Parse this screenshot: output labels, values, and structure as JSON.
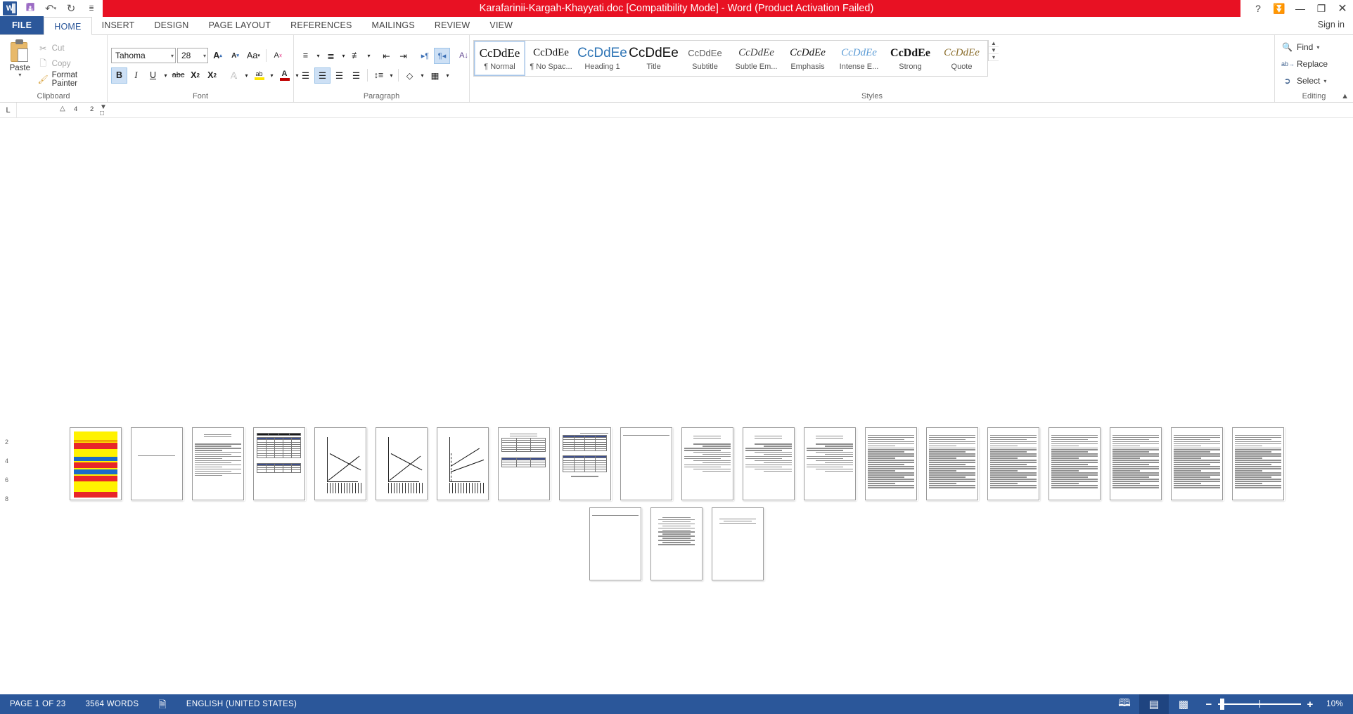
{
  "window": {
    "title": "Karafarinii-Kargah-Khayyati.doc [Compatibility Mode]  -  Word (Product Activation Failed)",
    "quick_access": [
      {
        "name": "word-logo",
        "glyph": "W"
      },
      {
        "name": "save-icon",
        "glyph": "💾"
      },
      {
        "name": "undo-icon",
        "glyph": "↶"
      },
      {
        "name": "redo-icon",
        "glyph": "↻"
      },
      {
        "name": "customize-qat-icon",
        "glyph": "≡"
      }
    ],
    "controls": [
      {
        "name": "help-button",
        "glyph": "?"
      },
      {
        "name": "ribbon-display-options-button",
        "glyph": "⤒"
      },
      {
        "name": "minimize-button",
        "glyph": "—"
      },
      {
        "name": "restore-button",
        "glyph": "❐"
      },
      {
        "name": "close-button",
        "glyph": "✕"
      }
    ],
    "sign_in": "Sign in"
  },
  "tabs": {
    "file": "FILE",
    "items": [
      "HOME",
      "INSERT",
      "DESIGN",
      "PAGE LAYOUT",
      "REFERENCES",
      "MAILINGS",
      "REVIEW",
      "VIEW"
    ],
    "active": "HOME"
  },
  "ribbon": {
    "clipboard": {
      "label": "Clipboard",
      "paste": "Paste",
      "cut": "Cut",
      "copy": "Copy",
      "format_painter": "Format Painter"
    },
    "font": {
      "label": "Font",
      "font_name": "Tahoma",
      "font_size": "28",
      "buttons": [
        {
          "name": "grow-font-button",
          "glyph": "A"
        },
        {
          "name": "shrink-font-button",
          "glyph": "A"
        },
        {
          "name": "change-case-button",
          "glyph": "Aa"
        },
        {
          "name": "clear-formatting-button",
          "glyph": "A"
        },
        {
          "name": "bold-button",
          "glyph": "B"
        },
        {
          "name": "italic-button",
          "glyph": "I"
        },
        {
          "name": "underline-button",
          "glyph": "U"
        },
        {
          "name": "strikethrough-button",
          "glyph": "abc"
        },
        {
          "name": "subscript-button",
          "glyph": "X"
        },
        {
          "name": "superscript-button",
          "glyph": "X"
        },
        {
          "name": "text-effects-button",
          "glyph": "A"
        },
        {
          "name": "text-highlight-color-button",
          "glyph": "ab"
        },
        {
          "name": "font-color-button",
          "glyph": "A"
        }
      ]
    },
    "paragraph": {
      "label": "Paragraph"
    },
    "styles": {
      "label": "Styles",
      "items": [
        {
          "preview": "CcDdEe",
          "name": "¶ Normal",
          "selected": true
        },
        {
          "preview": "CcDdEe",
          "name": "¶ No Spac...",
          "selected": false
        },
        {
          "preview": "CcDdEe",
          "name": "Heading 1",
          "selected": false
        },
        {
          "preview": "CcDdEe",
          "name": "Title",
          "selected": false
        },
        {
          "preview": "CcDdEe",
          "name": "Subtitle",
          "selected": false
        },
        {
          "preview": "CcDdEe",
          "name": "Subtle Em...",
          "selected": false
        },
        {
          "preview": "CcDdEe",
          "name": "Emphasis",
          "selected": false
        },
        {
          "preview": "CcDdEe",
          "name": "Intense E...",
          "selected": false
        },
        {
          "preview": "CcDdEe",
          "name": "Strong",
          "selected": false
        },
        {
          "preview": "CcDdEe",
          "name": "Quote",
          "selected": false
        }
      ]
    },
    "editing": {
      "label": "Editing",
      "find": "Find",
      "replace": "Replace",
      "select": "Select"
    }
  },
  "ruler": {
    "tabstop_glyph": "L",
    "ticks": [
      "4",
      "2"
    ]
  },
  "status": {
    "page": "PAGE 1 OF 23",
    "words": "3564 WORDS",
    "proofing_icon": "proofing-errors-icon",
    "language": "ENGLISH (UNITED STATES)",
    "views": [
      {
        "name": "read-mode-button",
        "glyph": "📖",
        "active": false
      },
      {
        "name": "print-layout-button",
        "glyph": "▤",
        "active": true
      },
      {
        "name": "web-layout-button",
        "glyph": "▥",
        "active": false
      }
    ],
    "zoom_out": "−",
    "zoom_in": "+",
    "zoom_level": "10%"
  },
  "document": {
    "page_count": 23,
    "thumbnails": [
      {
        "index": 1,
        "kind": "cover"
      },
      {
        "index": 2,
        "kind": "title-only"
      },
      {
        "index": 3,
        "kind": "toc"
      },
      {
        "index": 4,
        "kind": "table-dark"
      },
      {
        "index": 5,
        "kind": "chart-line"
      },
      {
        "index": 6,
        "kind": "chart-line"
      },
      {
        "index": 7,
        "kind": "chart-curve"
      },
      {
        "index": 8,
        "kind": "table-small"
      },
      {
        "index": 9,
        "kind": "table-grid"
      },
      {
        "index": 10,
        "kind": "blank-head"
      },
      {
        "index": 11,
        "kind": "table-list"
      },
      {
        "index": 12,
        "kind": "table-list"
      },
      {
        "index": 13,
        "kind": "table-list"
      },
      {
        "index": 14,
        "kind": "text"
      },
      {
        "index": 15,
        "kind": "text"
      },
      {
        "index": 16,
        "kind": "text"
      },
      {
        "index": 17,
        "kind": "text"
      },
      {
        "index": 18,
        "kind": "text"
      },
      {
        "index": 19,
        "kind": "text"
      },
      {
        "index": 20,
        "kind": "text"
      },
      {
        "index": 21,
        "kind": "blank-head"
      },
      {
        "index": 22,
        "kind": "poem"
      },
      {
        "index": 23,
        "kind": "closing"
      }
    ]
  },
  "colors": {
    "title_bar": "#E81123",
    "accent": "#2B579A",
    "status_bar": "#2B579A",
    "style_selected_border": "#A7C5E8"
  }
}
